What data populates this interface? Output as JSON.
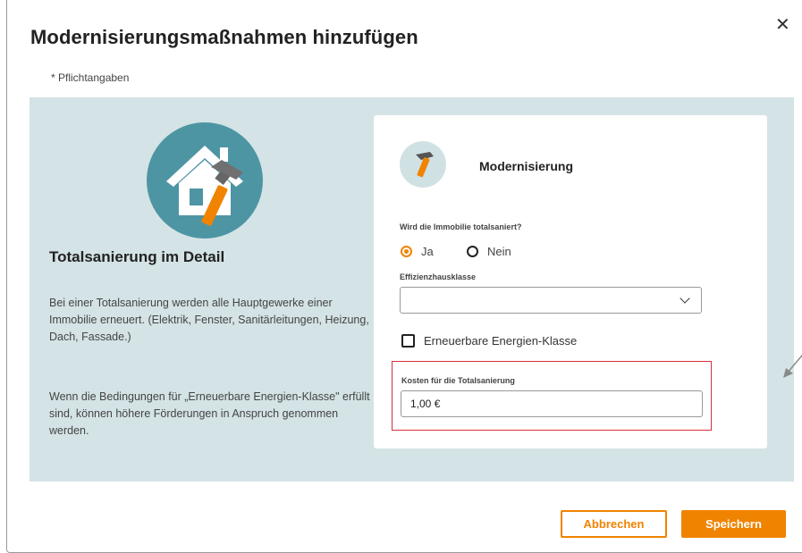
{
  "dialog": {
    "title": "Modernisierungsmaßnahmen hinzufügen",
    "close_icon": "close-icon",
    "required_note": "* Pflichtangaben"
  },
  "info": {
    "hero_icon": "house-hammer-icon",
    "title": "Totalsanierung im Detail",
    "paragraph1": "Bei einer Totalsanierung werden alle Hauptgewerke einer Immobilie erneuert. (Elektrik, Fenster, Sanitärleitungen, Heizung, Dach, Fassade.)",
    "paragraph2": "Wenn die Bedingungen für „Erneuerbare Energien-Klasse\" erfüllt sind, können höhere Förderungen in Anspruch genommen werden."
  },
  "form": {
    "icon": "hammer-icon",
    "title": "Modernisierung",
    "total_question": "Wird die Immobilie totalsaniert?",
    "radio_yes": "Ja",
    "radio_no": "Nein",
    "radio_selected": "Ja",
    "efficiency_label": "Effizienzhausklasse",
    "efficiency_value": "",
    "renewable_label": "Erneuerbare Energien-Klasse",
    "renewable_checked": false,
    "cost_label": "Kosten für die Totalsanierung",
    "cost_value": "1,00 €"
  },
  "actions": {
    "cancel_label": "Abbrechen",
    "save_label": "Speichern"
  },
  "colors": {
    "accent": "#f08300",
    "panel_bg": "#d4e3e5",
    "icon_teal": "#4e95a4",
    "highlight": "#d6303a"
  }
}
